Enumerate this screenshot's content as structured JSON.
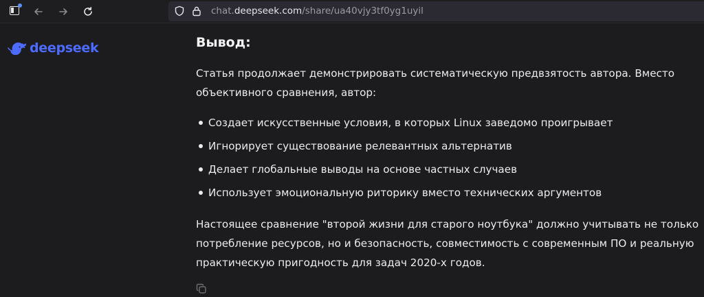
{
  "browser": {
    "url_prefix": "chat.",
    "url_domain": "deepseek.com",
    "url_path": "/share/ua40vjy3tf0yg1uyil"
  },
  "sidebar": {
    "logo_text": "deepseek"
  },
  "message": {
    "heading": "Вывод:",
    "intro": "Статья продолжает демонстрировать систематическую предвзятость автора. Вместо объективного сравнения, автор:",
    "bullets": [
      "Создает искусственные условия, в которых Linux заведомо проигрывает",
      "Игнорирует существование релевантных альтернатив",
      "Делает глобальные выводы на основе частных случаев",
      "Использует эмоциональную риторику вместо технических аргументов"
    ],
    "conclusion": "Настоящее сравнение \"второй жизни для старого ноутбука\" должно учитывать не только потребление ресурсов, но и безопасность, совместимость с современным ПО и реальную практическую пригодность для задач 2020-х годов."
  },
  "colors": {
    "background": "#1c1c1e",
    "brand": "#4d6bfe",
    "text": "#ececf0"
  },
  "icons": {
    "tab": "sidebar-tab-icon",
    "back": "arrow-left-icon",
    "forward": "arrow-right-icon",
    "reload": "reload-icon",
    "shield": "shield-icon",
    "lock": "lock-icon",
    "logo": "whale-icon",
    "copy": "copy-icon"
  }
}
